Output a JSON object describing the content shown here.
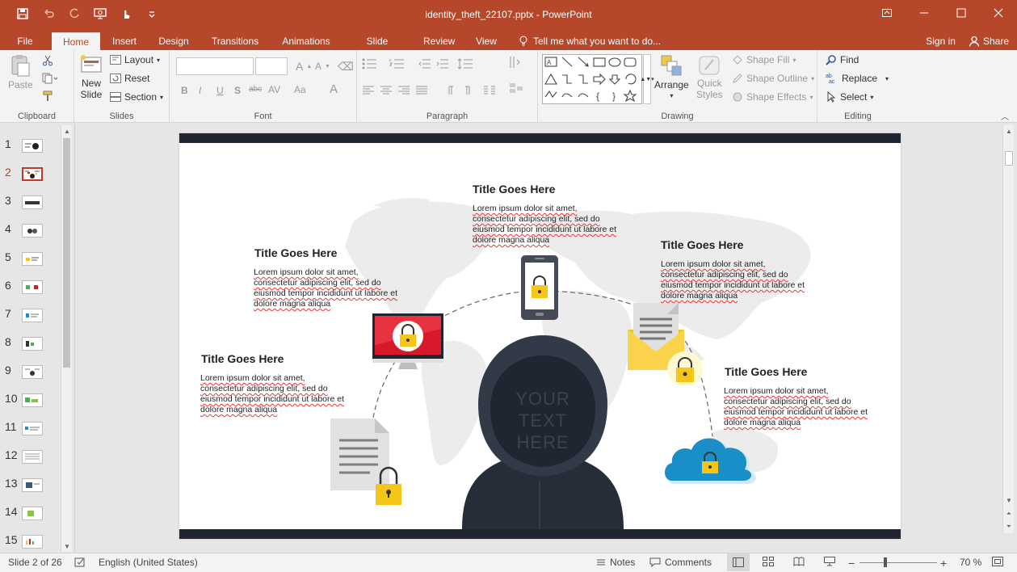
{
  "window": {
    "title": "identity_theft_22107.pptx - PowerPoint"
  },
  "tabs": [
    {
      "label": "File",
      "active": false
    },
    {
      "label": "Home",
      "active": true
    },
    {
      "label": "Insert",
      "active": false
    },
    {
      "label": "Design",
      "active": false
    },
    {
      "label": "Transitions",
      "active": false
    },
    {
      "label": "Animations",
      "active": false
    },
    {
      "label": "Slide Show",
      "active": false
    },
    {
      "label": "Review",
      "active": false
    },
    {
      "label": "View",
      "active": false
    }
  ],
  "tell_me": "Tell me what you want to do...",
  "account": {
    "sign_in": "Sign in",
    "share": "Share"
  },
  "ribbon": {
    "clipboard": {
      "label": "Clipboard",
      "paste": "Paste"
    },
    "slides": {
      "label": "Slides",
      "new_slide_1": "New",
      "new_slide_2": "Slide",
      "layout": "Layout",
      "reset": "Reset",
      "section": "Section"
    },
    "font": {
      "label": "Font"
    },
    "paragraph": {
      "label": "Paragraph"
    },
    "drawing": {
      "label": "Drawing",
      "arrange": "Arrange",
      "quick_styles_1": "Quick",
      "quick_styles_2": "Styles",
      "shape_fill": "Shape Fill",
      "shape_outline": "Shape Outline",
      "shape_effects": "Shape Effects"
    },
    "editing": {
      "label": "Editing",
      "find": "Find",
      "replace": "Replace",
      "select": "Select"
    }
  },
  "thumbnails": {
    "numbers": [
      "1",
      "2",
      "3",
      "4",
      "5",
      "6",
      "7",
      "8",
      "9",
      "10",
      "11",
      "12",
      "13",
      "14",
      "15"
    ],
    "active_index": 2
  },
  "slide": {
    "boxes": [
      {
        "title": "Title Goes Here",
        "body": "Lorem ipsum dolor sit amet, consectetur adipiscing elit, sed do eiusmod tempor incididunt ut labore et dolore magna aliqua"
      },
      {
        "title": "Title Goes Here",
        "body": "Lorem ipsum dolor sit amet, consectetur adipiscing elit, sed do eiusmod tempor incididunt ut labore et dolore magna aliqua"
      },
      {
        "title": "Title Goes Here",
        "body": "Lorem ipsum dolor sit amet, consectetur adipiscing elit, sed do eiusmod tempor incididunt ut labore et dolore magna aliqua"
      },
      {
        "title": "Title Goes Here",
        "body": "Lorem ipsum dolor sit amet, consectetur adipiscing elit, sed do eiusmod tempor incididunt ut labore et dolore magna aliqua"
      },
      {
        "title": "Title Goes Here",
        "body": "Lorem ipsum dolor sit amet, consectetur adipiscing elit, sed do eiusmod tempor incididunt ut labore et dolore magna aliqua"
      }
    ],
    "hood_text": [
      "YOUR",
      "TEXT",
      "HERE"
    ],
    "colors": {
      "band": "#1f2631",
      "lock": "#f5c518",
      "red": "#d7192a",
      "cloud": "#1a8ec6",
      "hood": "#262d38"
    }
  },
  "status": {
    "slide_info": "Slide 2 of 26",
    "language": "English (United States)",
    "notes": "Notes",
    "comments": "Comments",
    "zoom": "70 %"
  },
  "accent": "#b7472a"
}
